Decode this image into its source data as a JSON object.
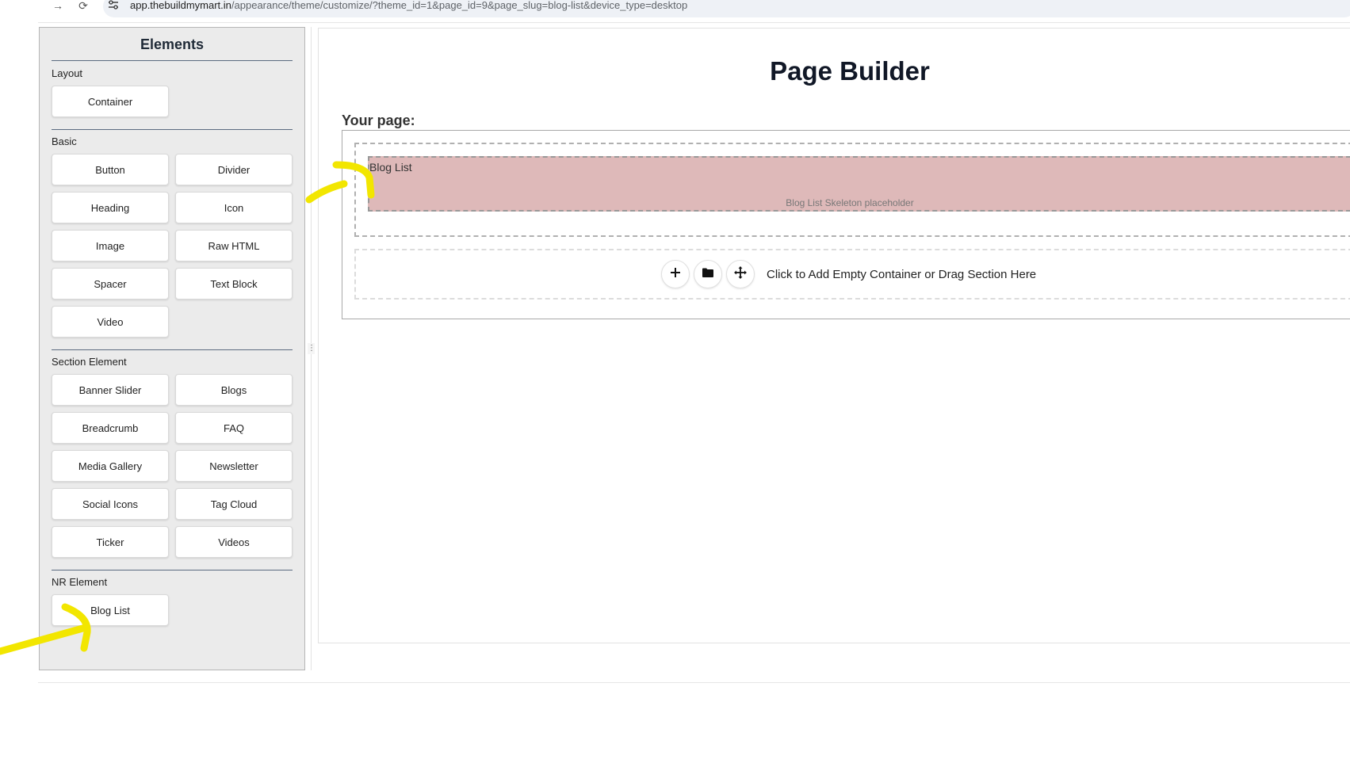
{
  "browser": {
    "url_host": "app.thebuildmymart.in",
    "url_path": "/appearance/theme/customize/?theme_id=1&page_id=9&page_slug=blog-list&device_type=desktop"
  },
  "sidebar": {
    "title": "Elements",
    "sections": [
      {
        "label": "Layout",
        "items": [
          "Container"
        ]
      },
      {
        "label": "Basic",
        "items": [
          "Button",
          "Divider",
          "Heading",
          "Icon",
          "Image",
          "Raw HTML",
          "Spacer",
          "Text Block",
          "Video"
        ]
      },
      {
        "label": "Section Element",
        "items": [
          "Banner Slider",
          "Blogs",
          "Breadcrumb",
          "FAQ",
          "Media Gallery",
          "Newsletter",
          "Social Icons",
          "Tag Cloud",
          "Ticker",
          "Videos"
        ]
      },
      {
        "label": "NR Element",
        "items": [
          "Blog List"
        ]
      }
    ]
  },
  "canvas": {
    "title": "Page Builder",
    "your_page_label": "Your page:",
    "blog_block": {
      "label": "Blog List",
      "placeholder": "Blog List Skeleton placeholder"
    },
    "add_zone": {
      "hint": "Click to Add Empty Container or Drag Section Here"
    }
  },
  "annotations": {
    "highlight_color": "#f2e600"
  },
  "icons": {
    "back": "arrow-right-icon",
    "reload": "reload-icon",
    "site_settings": "tune-icon",
    "drag_handle": "grip-icon",
    "add": "plus-icon",
    "folder": "folder-icon",
    "move": "move-icon"
  }
}
